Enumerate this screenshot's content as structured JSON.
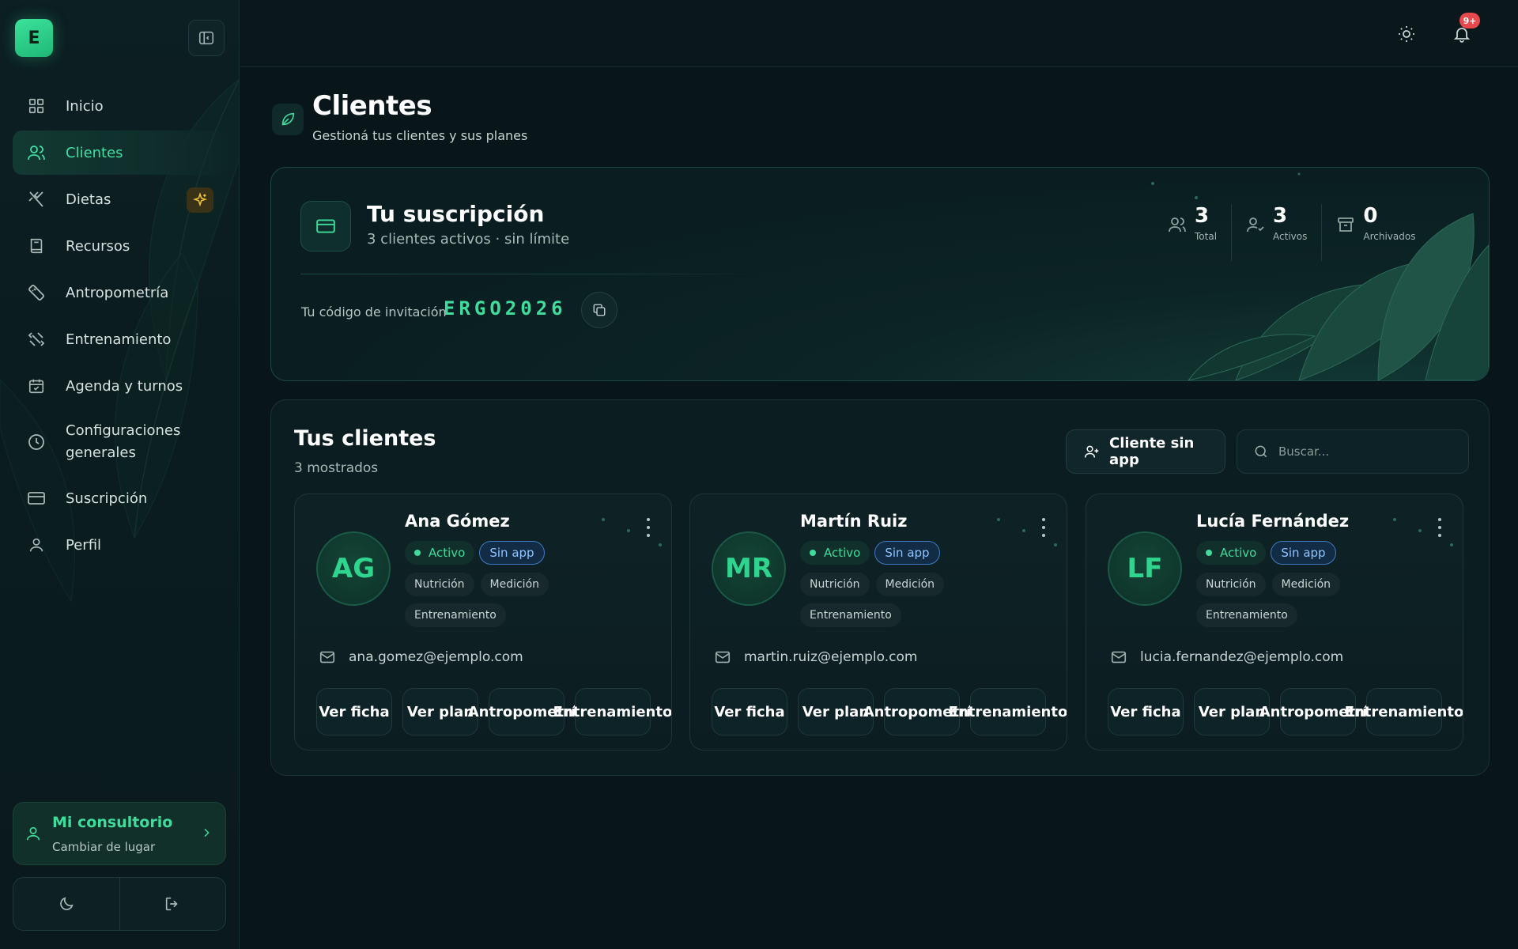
{
  "sidebar": {
    "logo_letter": "E",
    "items": [
      {
        "label": "Inicio",
        "icon": "dashboard-icon"
      },
      {
        "label": "Clientes",
        "icon": "users-icon",
        "active": true
      },
      {
        "label": "Dietas",
        "icon": "utensils-icon",
        "badge_icon": "sparkles-icon"
      },
      {
        "label": "Recursos",
        "icon": "book-icon"
      },
      {
        "label": "Antropometría",
        "icon": "ruler-icon"
      },
      {
        "label": "Entrenamiento",
        "icon": "dumbbell-icon"
      },
      {
        "label": "Agenda y turnos",
        "icon": "calendar-icon"
      },
      {
        "label": "Configuraciones generales",
        "icon": "clock-icon"
      },
      {
        "label": "Suscripción",
        "icon": "credit-card-icon"
      },
      {
        "label": "Perfil",
        "icon": "user-icon"
      }
    ],
    "place_card": {
      "title": "Mi consultorio",
      "subtitle": "Cambiar de lugar"
    }
  },
  "topbar": {
    "notifications_count": "9+"
  },
  "page": {
    "title": "Clientes",
    "subtitle": "Gestioná tus clientes y sus planes"
  },
  "subscription": {
    "title": "Tu suscripción",
    "description": "3 clientes activos · sin límite",
    "invite_label": "Tu código de invitación",
    "invite_code": "ERGO2026",
    "stats": [
      {
        "value": "3",
        "label": "Total",
        "icon": "users-icon"
      },
      {
        "value": "3",
        "label": "Activos",
        "icon": "user-check-icon"
      },
      {
        "value": "0",
        "label": "Archivados",
        "icon": "archive-icon"
      }
    ]
  },
  "clients": {
    "title": "Tus clientes",
    "count_text": "3 mostrados",
    "add_button": "Cliente sin app",
    "search_placeholder": "Buscar...",
    "cards": [
      {
        "initials": "AG",
        "name": "Ana Gómez",
        "status": "Activo",
        "app_badge": "Sin app",
        "tags": [
          "Nutrición",
          "Medición",
          "Entrenamiento"
        ],
        "email": "ana.gomez@ejemplo.com",
        "actions": [
          "Ver ficha",
          "Ver plan",
          "Antropometría",
          "Entrenamiento"
        ]
      },
      {
        "initials": "MR",
        "name": "Martín Ruiz",
        "status": "Activo",
        "app_badge": "Sin app",
        "tags": [
          "Nutrición",
          "Medición",
          "Entrenamiento"
        ],
        "email": "martin.ruiz@ejemplo.com",
        "actions": [
          "Ver ficha",
          "Ver plan",
          "Antropometría",
          "Entrenamiento"
        ]
      },
      {
        "initials": "LF",
        "name": "Lucía Fernández",
        "status": "Activo",
        "app_badge": "Sin app",
        "tags": [
          "Nutrición",
          "Medición",
          "Entrenamiento"
        ],
        "email": "lucia.fernandez@ejemplo.com",
        "actions": [
          "Ver ficha",
          "Ver plan",
          "Antropometría",
          "Entrenamiento"
        ]
      }
    ]
  },
  "colors": {
    "accent": "#3fdc9c",
    "background": "#081519",
    "badge_blue": "#8fc4ff",
    "notification": "#e5484d"
  }
}
